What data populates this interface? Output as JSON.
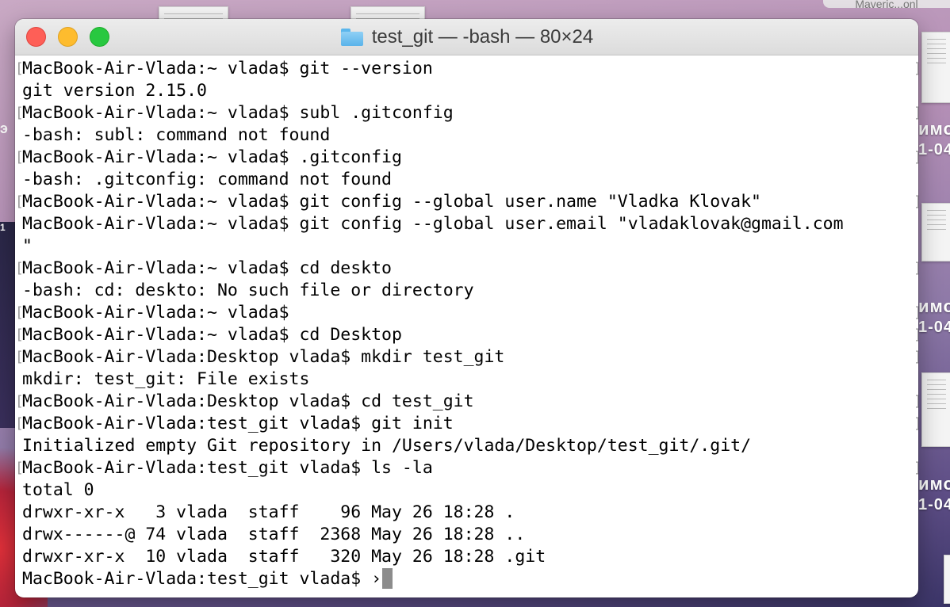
{
  "window": {
    "title": "test_git — -bash — 80×24"
  },
  "desktop": {
    "top_right_label": "Maveric...onl",
    "right_labels": [
      {
        "top": "имо",
        "bottom": "1-04"
      },
      {
        "top": "имо",
        "bottom": "1-04"
      },
      {
        "top": "имо",
        "bottom": "1-04"
      }
    ],
    "left_labels": [
      "э",
      "1"
    ]
  },
  "terminal": {
    "lines": [
      {
        "text": "MacBook-Air-Vlada:~ vlada$ git --version",
        "mark": true
      },
      {
        "text": "git version 2.15.0",
        "mark": false
      },
      {
        "text": "MacBook-Air-Vlada:~ vlada$ subl .gitconfig",
        "mark": true
      },
      {
        "text": "-bash: subl: command not found",
        "mark": false
      },
      {
        "text": "MacBook-Air-Vlada:~ vlada$ .gitconfig",
        "mark": true
      },
      {
        "text": "-bash: .gitconfig: command not found",
        "mark": false
      },
      {
        "text": "MacBook-Air-Vlada:~ vlada$ git config --global user.name \"Vladka Klovak\"",
        "mark": true
      },
      {
        "text": "MacBook-Air-Vlada:~ vlada$ git config --global user.email \"vladaklovak@gmail.com",
        "mark": false
      },
      {
        "text": "\"",
        "mark": false
      },
      {
        "text": "MacBook-Air-Vlada:~ vlada$ cd deskto",
        "mark": true
      },
      {
        "text": "-bash: cd: deskto: No such file or directory",
        "mark": false
      },
      {
        "text": "MacBook-Air-Vlada:~ vlada$",
        "mark": true
      },
      {
        "text": "MacBook-Air-Vlada:~ vlada$ cd Desktop",
        "mark": true
      },
      {
        "text": "MacBook-Air-Vlada:Desktop vlada$ mkdir test_git",
        "mark": true
      },
      {
        "text": "mkdir: test_git: File exists",
        "mark": false
      },
      {
        "text": "MacBook-Air-Vlada:Desktop vlada$ cd test_git",
        "mark": true
      },
      {
        "text": "MacBook-Air-Vlada:test_git vlada$ git init",
        "mark": true
      },
      {
        "text": "Initialized empty Git repository in /Users/vlada/Desktop/test_git/.git/",
        "mark": false
      },
      {
        "text": "MacBook-Air-Vlada:test_git vlada$ ls -la",
        "mark": true
      },
      {
        "text": "total 0",
        "mark": false
      },
      {
        "text": "drwxr-xr-x   3 vlada  staff    96 May 26 18:28 .",
        "mark": false
      },
      {
        "text": "drwx------@ 74 vlada  staff  2368 May 26 18:28 ..",
        "mark": false
      },
      {
        "text": "drwxr-xr-x  10 vlada  staff   320 May 26 18:28 .git",
        "mark": false
      }
    ],
    "prompt": "MacBook-Air-Vlada:test_git vlada$ ›"
  }
}
